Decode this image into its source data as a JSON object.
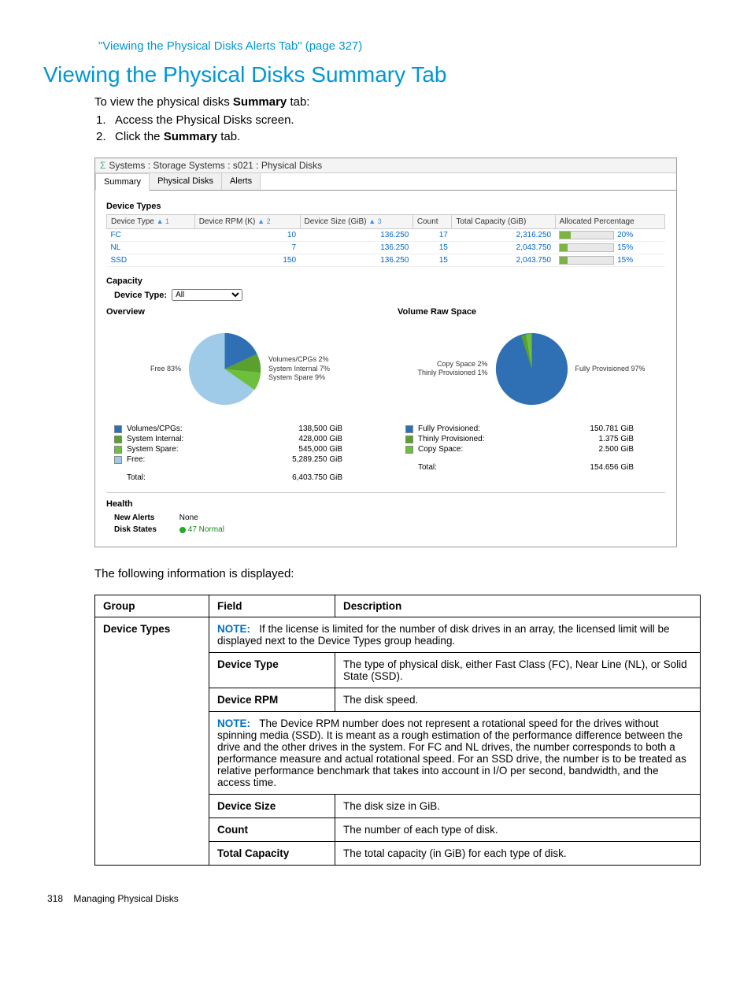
{
  "topLink": "\"Viewing the Physical Disks Alerts Tab\" (page 327)",
  "heading": "Viewing the Physical Disks Summary Tab",
  "intro_pre": "To view the physical disks ",
  "intro_bold": "Summary",
  "intro_post": " tab:",
  "step1_num": "1.",
  "step1": "Access the Physical Disks screen.",
  "step2_num": "2.",
  "step2_pre": "Click the ",
  "step2_bold": "Summary",
  "step2_post": " tab.",
  "sshot": {
    "titleBar": "Systems : Storage Systems : s021 : Physical Disks",
    "tabSummary": "Summary",
    "tabPhysDisks": "Physical Disks",
    "tabAlerts": "Alerts",
    "grpDeviceTypes": "Device Types",
    "th_devtype": "Device Type",
    "th_sort1": "▲ 1",
    "th_rpm": "Device RPM (K)",
    "th_sort2": "▲ 2",
    "th_size": "Device Size (GiB)",
    "th_sort3": "▲ 3",
    "th_count": "Count",
    "th_total": "Total Capacity (GiB)",
    "th_alloc": "Allocated Percentage",
    "rows": [
      {
        "type": "FC",
        "rpm": "10",
        "size": "136.250",
        "count": "17",
        "total": "2,316.250",
        "pct": "20%",
        "w": 20
      },
      {
        "type": "NL",
        "rpm": "7",
        "size": "136.250",
        "count": "15",
        "total": "2,043.750",
        "pct": "15%",
        "w": 15
      },
      {
        "type": "SSD",
        "rpm": "150",
        "size": "136.250",
        "count": "15",
        "total": "2,043.750",
        "pct": "15%",
        "w": 15
      }
    ],
    "grpCapacity": "Capacity",
    "lblDeviceType": "Device Type:",
    "selAll": "All",
    "ovHead": "Overview",
    "vrHead": "Volume Raw Space",
    "ov_legend": [
      {
        "label": "Volumes/CPGs:",
        "val": "138,500 GiB",
        "color": "#2f6fb3"
      },
      {
        "label": "System Internal:",
        "val": "428,000 GiB",
        "color": "#5aa02c"
      },
      {
        "label": "System Spare:",
        "val": "545,000 GiB",
        "color": "#6fbf3f"
      },
      {
        "label": "Free:",
        "val": "5,289.250 GiB",
        "color": "#9fcbe8"
      }
    ],
    "ov_total_lbl": "Total:",
    "ov_total_val": "6,403.750 GiB",
    "ov_free_lbl": "Free 83%",
    "ov_side1": "Volumes/CPGs 2%",
    "ov_side2": "System Internal 7%",
    "ov_side3": "System Spare 9%",
    "vr_legend": [
      {
        "label": "Fully Provisioned:",
        "val": "150.781 GiB",
        "color": "#2f6fb3"
      },
      {
        "label": "Thinly Provisioned:",
        "val": "1.375 GiB",
        "color": "#5aa02c"
      },
      {
        "label": "Copy Space:",
        "val": "2.500 GiB",
        "color": "#6fbf3f"
      }
    ],
    "vr_total_lbl": "Total:",
    "vr_total_val": "154.656 GiB",
    "vr_side_copy": "Copy Space 2%",
    "vr_side_thin": "Thinly Provisioned 1%",
    "vr_side_full": "Fully Provisioned 97%",
    "grpHealth": "Health",
    "healthNew": "New Alerts",
    "healthNone": "None",
    "healthDisk": "Disk States",
    "healthVal": "47 Normal"
  },
  "following": "The following information is displayed:",
  "infoHead": {
    "group": "Group",
    "field": "Field",
    "desc": "Description"
  },
  "info": {
    "groupLabel": "Device Types",
    "note1_pre": "If the license is limited for the number of disk drives in an array, the licensed limit will be displayed next to the Device Types group heading.",
    "noteLabel": "NOTE:",
    "f_devtype": "Device Type",
    "d_devtype": "The type of physical disk, either Fast Class (FC), Near Line (NL), or Solid State (SSD).",
    "f_rpm": "Device RPM",
    "d_rpm": "The disk speed.",
    "note2": "The Device RPM number does not represent a rotational speed for the drives without spinning media (SSD). It is meant as a rough estimation of the performance difference between the drive and the other drives in the system. For FC and NL drives, the number corresponds to both a performance measure and actual rotational speed. For an SSD drive, the number is to be treated as relative performance benchmark that takes into account in I/O per second, bandwidth, and the access time.",
    "f_size": "Device Size",
    "d_size": "The disk size in GiB.",
    "f_count": "Count",
    "d_count": "The number of each type of disk.",
    "f_total": "Total Capacity",
    "d_total": "The total capacity (in GiB) for each type of disk."
  },
  "footer": {
    "page": "318",
    "title": "Managing Physical Disks"
  }
}
